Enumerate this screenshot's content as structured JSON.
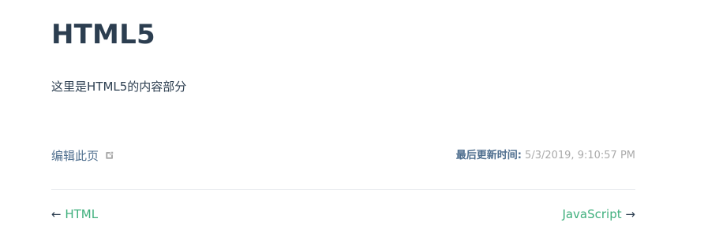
{
  "page": {
    "title": "HTML5",
    "body_text": "这里是HTML5的内容部分"
  },
  "meta": {
    "edit_link_label": "编辑此页",
    "last_updated_prefix": "最后更新时间:",
    "last_updated_value": "5/3/2019, 9:10:57 PM"
  },
  "nav": {
    "prev_arrow": "←",
    "prev_label": "HTML",
    "next_label": "JavaScript",
    "next_arrow": "→"
  },
  "colors": {
    "accent": "#3eaf7c",
    "text": "#2c3e50",
    "muted": "#aaaaaa",
    "edit_link": "#4e6e8e",
    "divider": "#eaecef"
  }
}
